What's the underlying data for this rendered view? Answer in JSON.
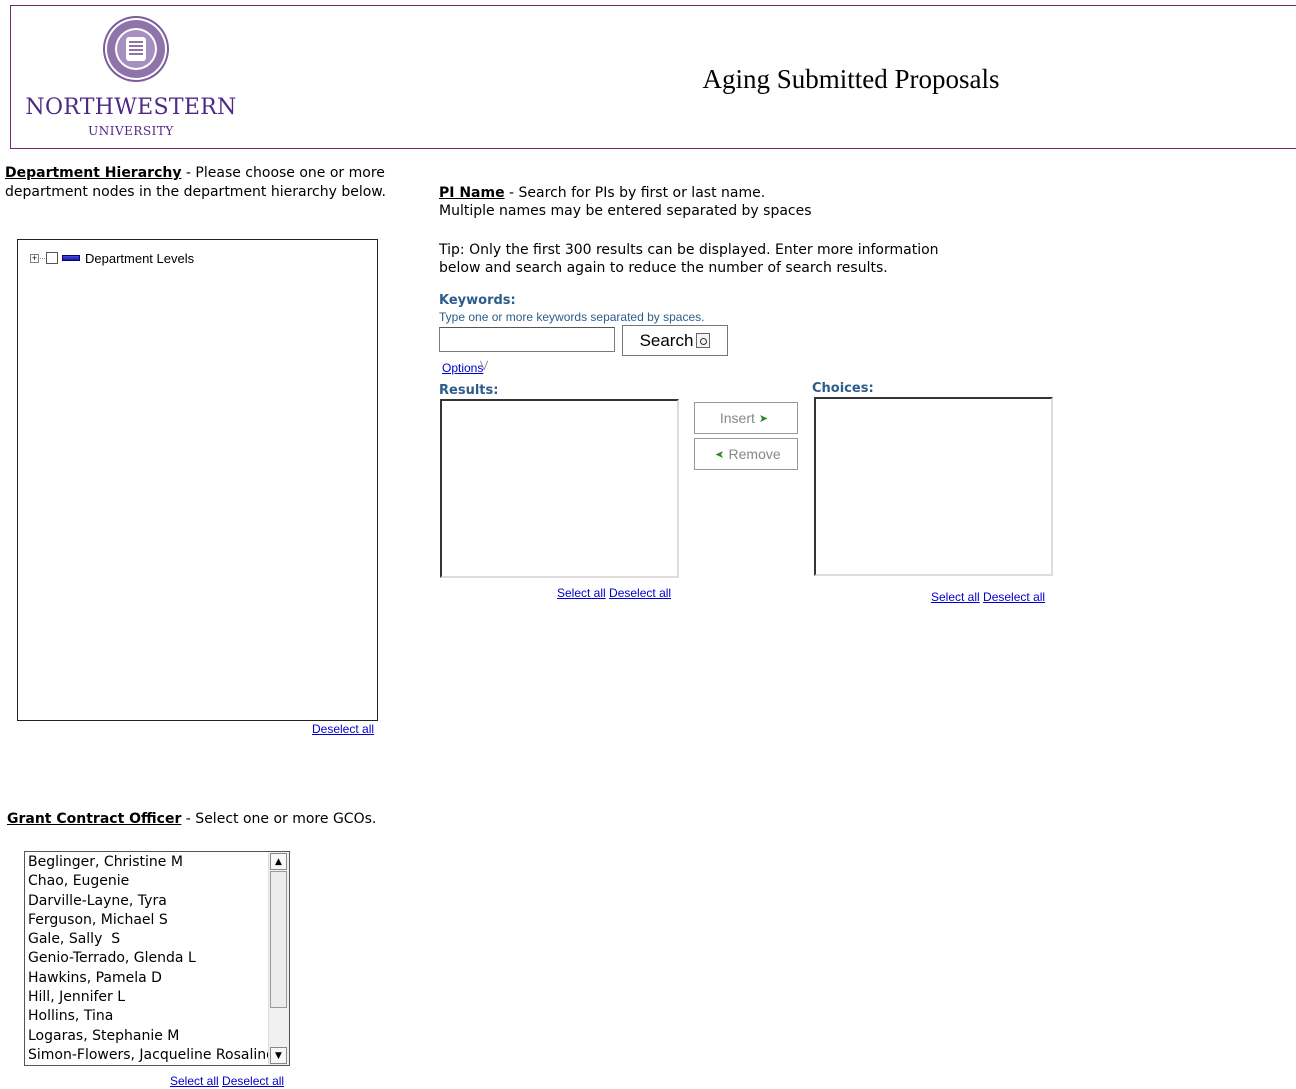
{
  "header": {
    "university_name": "NORTHWESTERN",
    "university_sub": "UNIVERSITY",
    "seal_text": "NORTHWESTERN UNIVERSITY 1851",
    "page_title": "Aging Submitted Proposals",
    "brand_color": "#4e2a84"
  },
  "department": {
    "title": "Department Hierarchy",
    "description_rest": " - Please choose one or more department nodes in the department hierarchy below.",
    "tree_root_label": "Department Levels",
    "deselect_all": "Deselect all"
  },
  "pi": {
    "title": "PI Name",
    "description_line1_rest": " - Search for PIs by first or last name.",
    "description_line2": "Multiple names may be entered separated by spaces",
    "tip_line1": "Tip: Only the first 300 results can be displayed. Enter more information",
    "tip_line2": "below and search again to reduce the number of search results.",
    "keywords_label": "Keywords:",
    "keywords_hint": "Type one or more keywords separated by spaces.",
    "keywords_value": "",
    "search_label": "Search",
    "options_label": "Options",
    "results_label": "Results:",
    "choices_label": "Choices:",
    "insert_label": "Insert",
    "remove_label": "Remove",
    "select_all": "Select all",
    "deselect_all": "Deselect all"
  },
  "gco": {
    "title": "Grant Contract Officer",
    "description_rest": " - Select one or more GCOs.",
    "items": [
      "Beglinger, Christine M",
      "Chao, Eugenie",
      "Darville-Layne, Tyra",
      "Ferguson, Michael S",
      "Gale, Sally  S",
      "Genio-Terrado, Glenda L",
      "Hawkins, Pamela D",
      "Hill, Jennifer L",
      "Hollins, Tina",
      "Logaras, Stephanie M",
      "Simon-Flowers, Jacqueline Rosalind"
    ],
    "select_all": "Select all",
    "deselect_all": "Deselect all"
  }
}
